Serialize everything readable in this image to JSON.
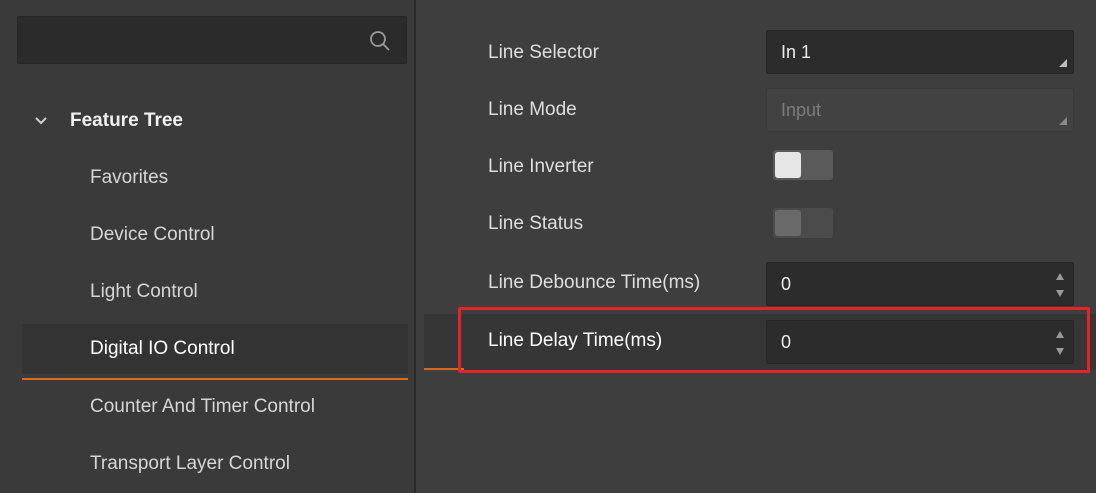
{
  "search": {
    "placeholder": ""
  },
  "tree": {
    "header": "Feature Tree",
    "items": [
      {
        "label": "Favorites"
      },
      {
        "label": "Device Control"
      },
      {
        "label": "Light Control"
      },
      {
        "label": "Digital IO Control",
        "active": true
      },
      {
        "label": "Counter And Timer Control"
      },
      {
        "label": "Transport Layer Control"
      }
    ]
  },
  "properties": {
    "line_selector": {
      "label": "Line Selector",
      "value": "In 1"
    },
    "line_mode": {
      "label": "Line Mode",
      "value": "Input"
    },
    "line_inverter": {
      "label": "Line Inverter",
      "on": false
    },
    "line_status": {
      "label": "Line Status",
      "on": false
    },
    "line_debounce": {
      "label": "Line Debounce Time(ms)",
      "value": "0"
    },
    "line_delay": {
      "label": "Line Delay Time(ms)",
      "value": "0"
    }
  },
  "colors": {
    "accent": "#d96a1c",
    "highlight": "#e3242b"
  }
}
